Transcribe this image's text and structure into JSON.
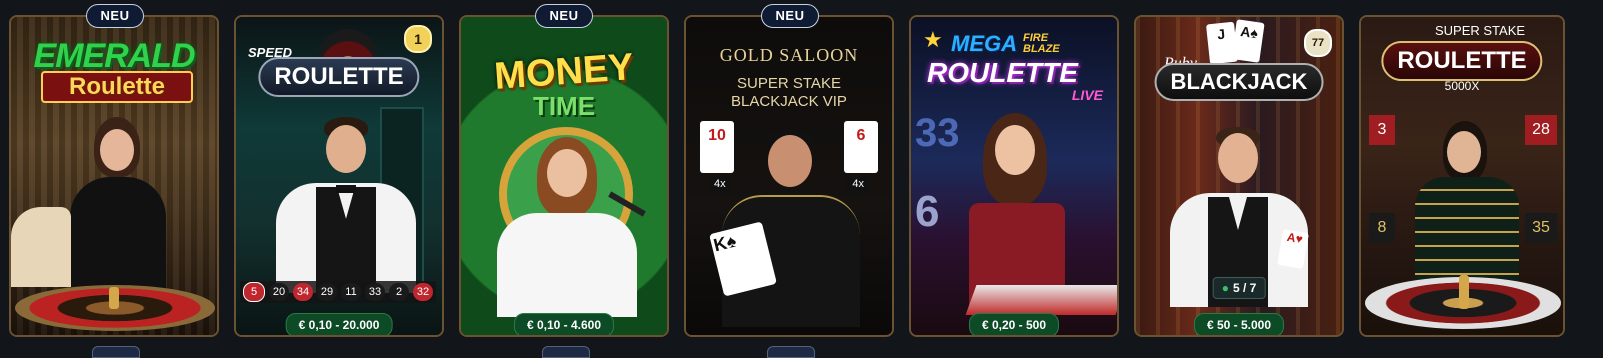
{
  "new_badge": "NEU",
  "cards": [
    {
      "title_line1": "EMERALD",
      "title_line2": "Roulette",
      "price": "",
      "new": true
    },
    {
      "title_small": "SPEED",
      "title_main": "ROULETTE",
      "rank": "1",
      "numbers": [
        "5",
        "20",
        "34",
        "29",
        "11",
        "33",
        "2",
        "32"
      ],
      "number_colors": [
        "#c0262d",
        "#1a1a1a",
        "#c0262d",
        "#1a1a1a",
        "#1a1a1a",
        "#1a1a1a",
        "#1a1a1a",
        "#c0262d"
      ],
      "price": "€ 0,10 - 20.000"
    },
    {
      "title_line1": "MONEY",
      "title_line2": "TIME",
      "price": "€ 0,10 - 4.600",
      "new": true
    },
    {
      "title_line1": "GOLD SALOON",
      "title_line2": "SUPER STAKE",
      "title_line3": "BLACKJACK VIP",
      "left_card": "10",
      "right_card": "6",
      "left_mult": "4x",
      "right_mult": "4x",
      "new": true
    },
    {
      "title_mega": "MEGA",
      "title_fire": "FIRE BLAZE",
      "title_main": "ROULETTE",
      "title_live": "LIVE",
      "price": "€ 0,20 - 500"
    },
    {
      "title_small": "Ruby",
      "title_main": "BLACKJACK",
      "rank": "77",
      "players": "5 / 7",
      "price": "€ 50 - 5.000"
    },
    {
      "title_top": "SUPER STAKE",
      "title_main": "ROULETTE",
      "title_sub": "5000X",
      "board_numbers": [
        "3",
        "28",
        "8",
        "35"
      ]
    }
  ]
}
